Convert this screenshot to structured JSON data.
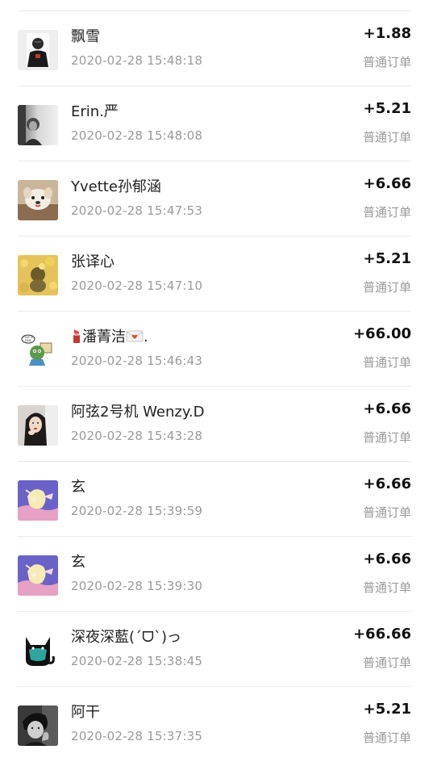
{
  "orders": [
    {
      "name": "飘雪",
      "time": "2020-02-28 15:48:18",
      "amount": "+1.88",
      "type": "普通订单",
      "avatar": "avatar-boy-dark-jacket"
    },
    {
      "name": "Erin.严",
      "time": "2020-02-28 15:48:08",
      "amount": "+5.21",
      "type": "普通订单",
      "avatar": "avatar-grayscale-portrait"
    },
    {
      "name": "Yvette孙郁涵",
      "time": "2020-02-28 15:47:53",
      "amount": "+6.66",
      "type": "普通订单",
      "avatar": "avatar-puppy"
    },
    {
      "name": "张译心",
      "time": "2020-02-28 15:47:10",
      "amount": "+5.21",
      "type": "普通订单",
      "avatar": "avatar-yellow-flowers"
    },
    {
      "name_prefix_icon": "lipstick-emoji",
      "name": "潘菁洁",
      "name_suffix_icon": "love-letter-emoji",
      "name_tail": ".",
      "time": "2020-02-28 15:46:43",
      "amount": "+66.00",
      "type": "普通订单",
      "avatar": "avatar-frog-this-is-fine"
    },
    {
      "name": "阿弦2号机 Wenzy.D",
      "time": "2020-02-28 15:43:28",
      "amount": "+6.66",
      "type": "普通订单",
      "avatar": "avatar-girl-portrait"
    },
    {
      "name": "玄",
      "time": "2020-02-28 15:39:59",
      "amount": "+6.66",
      "type": "普通订单",
      "avatar": "avatar-anime-purple"
    },
    {
      "name": "玄",
      "time": "2020-02-28 15:39:30",
      "amount": "+6.66",
      "type": "普通订单",
      "avatar": "avatar-anime-purple"
    },
    {
      "name": "深夜深藍(ˊᗜˋ)っ",
      "time": "2020-02-28 15:38:45",
      "amount": "+66.66",
      "type": "普通订单",
      "avatar": "avatar-black-cat-mask"
    },
    {
      "name": "阿干",
      "time": "2020-02-28 15:37:35",
      "amount": "+5.21",
      "type": "普通订单",
      "avatar": "avatar-bw-man"
    }
  ]
}
